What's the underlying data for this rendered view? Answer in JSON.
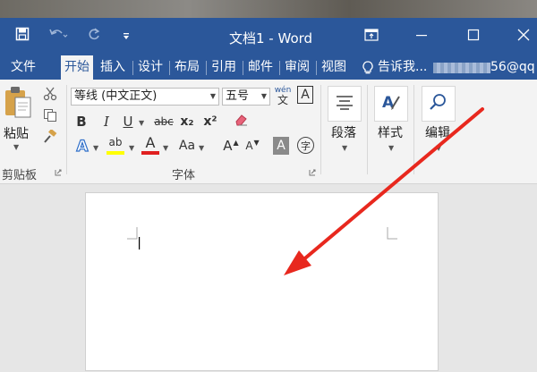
{
  "window": {
    "title": "文档1 - Word",
    "account_email": "56@qq",
    "colors": {
      "titlebar": "#2b579a",
      "ribbon": "#f3f3f3",
      "annotation_arrow": "#e8281e"
    }
  },
  "quick_access": {
    "icons": [
      "save-icon",
      "undo-icon",
      "redo-icon",
      "customize-dropdown-icon"
    ]
  },
  "window_controls": {
    "icons": [
      "ribbon-display-options-icon",
      "minimize-icon",
      "maximize-icon",
      "close-icon"
    ]
  },
  "tabs": [
    {
      "label": "文件"
    },
    {
      "label": "开始",
      "active": true
    },
    {
      "label": "插入"
    },
    {
      "label": "设计"
    },
    {
      "label": "布局"
    },
    {
      "label": "引用"
    },
    {
      "label": "邮件"
    },
    {
      "label": "审阅"
    },
    {
      "label": "视图"
    }
  ],
  "tell_me": {
    "placeholder": "告诉我..."
  },
  "ribbon": {
    "clipboard": {
      "paste_label": "粘贴",
      "group_label": "剪贴板"
    },
    "font": {
      "font_name": "等线 (中文正文)",
      "font_size": "五号",
      "phonetic_top": "wén",
      "phonetic_bottom": "文",
      "char_border": "A",
      "bold": "B",
      "italic": "I",
      "underline": "U",
      "strikethrough": "abc",
      "subscript": "x₂",
      "superscript": "x²",
      "text_effects": "A",
      "highlight": "ab",
      "font_color": "A",
      "change_case": "Aa",
      "grow_font": "A",
      "shrink_font": "A",
      "char_shading": "A",
      "enclose_char": "字",
      "group_label": "字体"
    },
    "paragraph": {
      "label": "段落"
    },
    "styles": {
      "label": "样式"
    },
    "editing": {
      "label": "编辑"
    }
  }
}
